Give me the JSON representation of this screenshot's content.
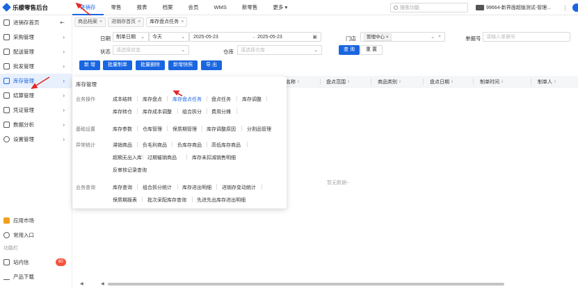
{
  "app": {
    "title": "乐檬零售后台"
  },
  "topnav": [
    "进销存",
    "零售",
    "报表",
    "档案",
    "会员",
    "WMS",
    "新零售",
    "更多"
  ],
  "topbar": {
    "search_placeholder": "搜索功能",
    "company": "99664-新界面超版测试-管理..."
  },
  "sidebar": {
    "items": [
      {
        "label": "进销存首页",
        "icon": "home-icon"
      },
      {
        "label": "采购管理",
        "icon": "cart-icon"
      },
      {
        "label": "配送管理",
        "icon": "delivery-icon"
      },
      {
        "label": "批发管理",
        "icon": "wholesale-icon"
      },
      {
        "label": "库存管理",
        "icon": "inventory-icon"
      },
      {
        "label": "结算管理",
        "icon": "settlement-icon"
      },
      {
        "label": "凭证管理",
        "icon": "voucher-icon"
      },
      {
        "label": "数据分析",
        "icon": "chart-icon"
      },
      {
        "label": "设置管理",
        "icon": "gear-icon"
      }
    ],
    "lower_items": [
      {
        "label": "应用市场",
        "icon": "appstore-icon"
      },
      {
        "label": "常用入口",
        "icon": "heart-icon"
      }
    ],
    "section_label": "功能栏",
    "bottom_items": [
      {
        "label": "站内信",
        "icon": "mail-icon",
        "badge": "60"
      },
      {
        "label": "产品下载",
        "icon": "download-icon"
      }
    ]
  },
  "tabs": [
    {
      "label": "商品档案"
    },
    {
      "label": "进销存首页"
    },
    {
      "label": "库存盘点任务"
    }
  ],
  "filters": {
    "date_label": "日期",
    "date_type": "制单日期",
    "date_range_preset": "今天",
    "date_start": "2025-05-23",
    "date_sep": "→",
    "date_end": "2025-05-23",
    "store_label": "门店",
    "store_tag": "管理中心",
    "order_no_label": "单据号",
    "order_no_placeholder": "请输入单据号",
    "status_label": "状态",
    "status_placeholder": "请选择状态",
    "warehouse_label": "仓库",
    "warehouse_placeholder": "请选择仓库",
    "query_btn": "查 询",
    "reset_btn": "重 置"
  },
  "actions": [
    "新 增",
    "批量制单",
    "批量删除",
    "新增快照",
    "导 出"
  ],
  "table": {
    "columns": [
      "名称",
      "盘点范围",
      "商品类别",
      "盘点日期",
      "制单时间",
      "制单人"
    ],
    "empty_text": "暂无数据~"
  },
  "menu": {
    "title": "库存管理",
    "groups": [
      {
        "label": "业务操作",
        "rows": [
          [
            "成本结转",
            "库存盘点",
            "库存盘点任务",
            "盘点任务",
            "库存调整"
          ],
          [
            "库存转仓",
            "库存成本调整",
            "组合拆分",
            "费用分摊"
          ]
        ]
      },
      {
        "label": "基础设置",
        "rows": [
          [
            "库存参数",
            "仓库管理",
            "保质期管理",
            "库存调整原因",
            "分割品管理"
          ]
        ]
      },
      {
        "label": "异常统计",
        "rows": [
          [
            "滞销商品",
            "负毛利商品",
            "负库存商品",
            "高低库存商品"
          ],
          [
            "超期无出入库",
            "过期催销商品",
            "库存未扣减销售明细"
          ],
          [
            "反审核记录查询"
          ]
        ]
      },
      {
        "label": "业务查询",
        "rows": [
          [
            "库存查询",
            "组合拆分统计",
            "库存进出明细",
            "进销存变动统计"
          ],
          [
            "保质期报表",
            "批次采配库存查询",
            "先进先出库存进出明细"
          ]
        ]
      }
    ],
    "active_item": "库存盘点任务"
  },
  "colors": {
    "accent": "#1a66e0",
    "badge": "#f5533d",
    "arrow": "#e02828"
  }
}
